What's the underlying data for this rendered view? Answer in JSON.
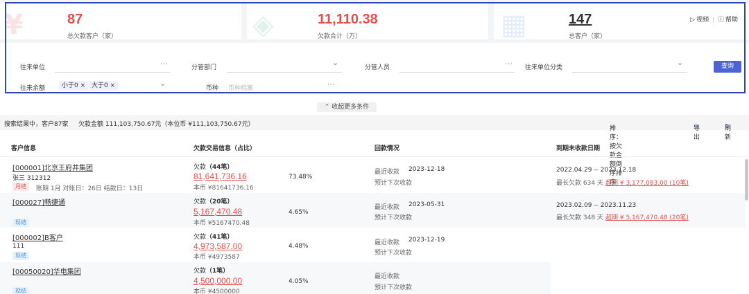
{
  "stats": [
    {
      "value": "87",
      "label": "总欠款客户（家）",
      "icon": "yen-coin-icon"
    },
    {
      "value": "11,110.38",
      "label": "欠款合计（万）",
      "icon": "document-stamp-icon"
    },
    {
      "value": "147",
      "label": "总客户（家）",
      "icon": "building-icon"
    }
  ],
  "help": {
    "video_label": "视频",
    "help_label": "帮助"
  },
  "filters": {
    "partner_label": "往来单位",
    "dept_label": "分管部门",
    "staff_label": "分管人员",
    "category_label": "往来单位分类",
    "balance_label": "往来余额",
    "balance_tags": [
      "小于0",
      "大于0"
    ],
    "currency_label": "币种",
    "currency_placeholder": "币种档案",
    "query_button": "查询"
  },
  "collapse_label": "收起更多条件",
  "summary": {
    "result_text": "搜索结果中，客户87家",
    "amount_text": "欠款金额 111,103,750.67元（本位币 ¥111,103,750.67元）",
    "sort_text": "排序：按欠款金额倒序排序",
    "export_label": "导出",
    "refresh_label": "刷新"
  },
  "table": {
    "headers": [
      "客户信息",
      "欠款交易信息（占比）",
      "回款情况",
      "到期未收款日期"
    ],
    "rows": [
      {
        "customer": "[000001]北京王府井集团",
        "contact": "张三  312312",
        "badge": "月结",
        "terms": "账期  1月    对账日：26日  结款日：13日",
        "debt_title": "欠款",
        "debt_count": "（44笔）",
        "amount": "81,641,736.16",
        "base_amount": "本币 ¥81641736.16",
        "ratio": "73.48%",
        "last_label": "最近收款",
        "last_date": "2023-12-18",
        "next_label": "预计下次收款",
        "due_range": "2022.04.29 -- 2023.12.18",
        "max_days": "最长欠款 634 天",
        "overdue": "超期 ¥ 3,177,083.00 (10笔)"
      },
      {
        "customer": "[000027]畅捷通",
        "contact": "",
        "badge": "现结",
        "terms": "",
        "debt_title": "欠款",
        "debt_count": "（20笔）",
        "amount": "5,167,470.48",
        "base_amount": "本币 ¥5167470.48",
        "ratio": "4.65%",
        "last_label": "最近收款",
        "last_date": "2023-05-31",
        "next_label": "预计下次收款",
        "due_range": "2023.02.09 -- 2023.11.23",
        "max_days": "最长欠款 348 天",
        "overdue": "超期 ¥ 5,167,470.48 (20笔)"
      },
      {
        "customer": "[000002]B客户",
        "contact": "111",
        "badge": "现结",
        "terms": "",
        "debt_title": "欠款",
        "debt_count": "（41笔）",
        "amount": "4,973,587.00",
        "base_amount": "本币 ¥4973587",
        "ratio": "4.48%",
        "last_label": "最近收款",
        "last_date": "2023-12-19",
        "next_label": "预计下次收款",
        "due_range": "",
        "max_days": "",
        "overdue": ""
      },
      {
        "customer": "[00050020]华电集团",
        "contact": "",
        "badge": "现结",
        "terms": "",
        "debt_title": "欠款",
        "debt_count": "（1笔）",
        "amount": "4,500,000.00",
        "base_amount": "本币 ¥4500000",
        "ratio": "4.05%",
        "last_label": "最近收款",
        "last_date": "",
        "next_label": "预计下次收款",
        "due_range": "",
        "max_days": "",
        "overdue": ""
      }
    ]
  },
  "colors": {
    "accent": "#4c63d6",
    "danger": "#e24f4f",
    "frame": "#2e45b8"
  }
}
